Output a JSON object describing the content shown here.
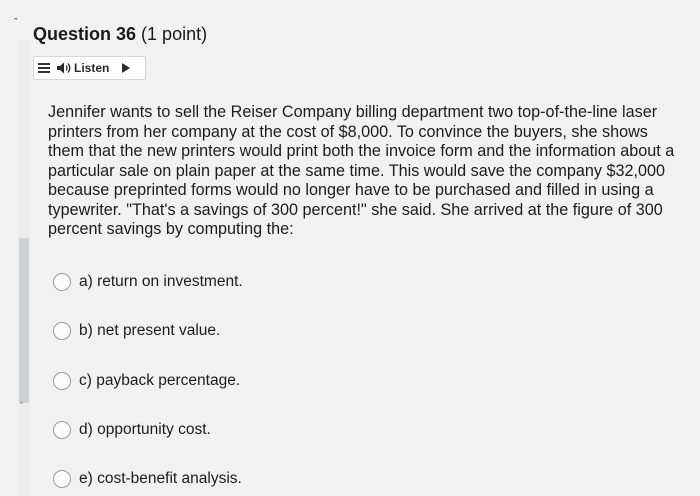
{
  "question": {
    "title": "Question 36",
    "points": "(1 point)",
    "text": "Jennifer wants to sell the Reiser Company billing department two top-of-the-line laser printers from her company at the cost of $8,000. To convince the buyers, she shows them that the new printers would print both the invoice form and the information about a particular sale on plain paper at the same time. This would save the company $32,000 because preprinted forms would no longer have to be purchased and filled in using a typewriter. \"That's a savings of 300 percent!\" she said. She arrived at the figure of 300 percent savings by computing the:"
  },
  "listen": {
    "label": "Listen",
    "menu_icon": "hamburger-icon",
    "speaker_icon": "speaker-icon",
    "play_icon": "play-icon"
  },
  "options": [
    {
      "label": "a) return on investment."
    },
    {
      "label": "b) net present value."
    },
    {
      "label": "c) payback percentage."
    },
    {
      "label": "d) opportunity cost."
    },
    {
      "label": "e) cost-benefit analysis."
    }
  ],
  "colors": {
    "background": "#f1f1f2",
    "text": "#1c1c1c",
    "radio_border": "#9a9a9a"
  }
}
